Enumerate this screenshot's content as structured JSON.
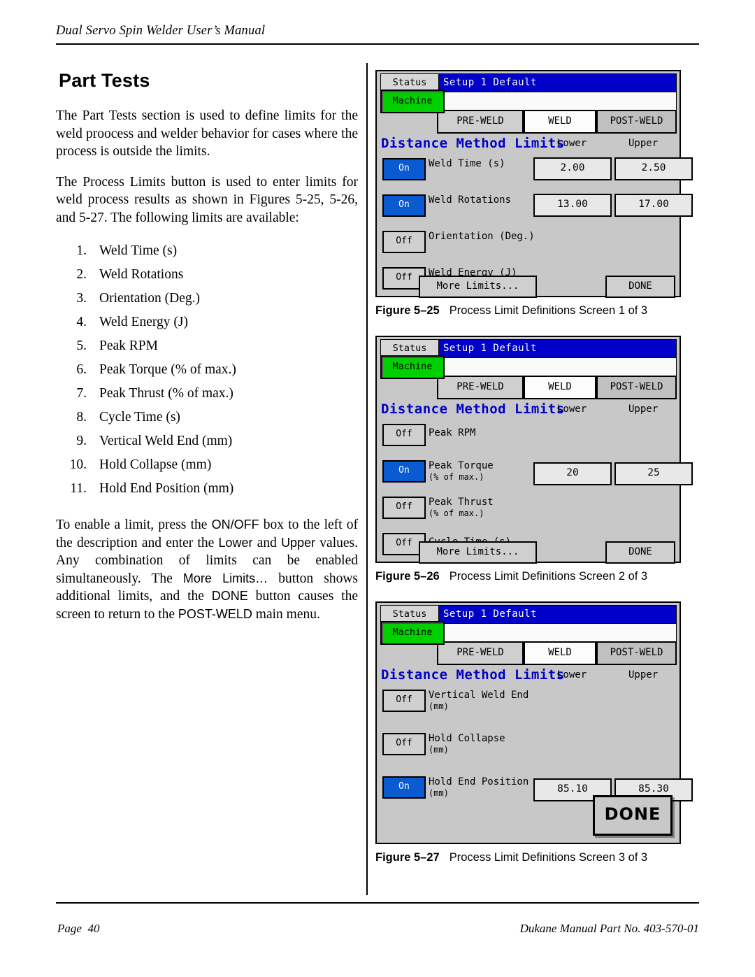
{
  "header": {
    "title": "Dual Servo Spin Welder User’s Manual"
  },
  "footer": {
    "page_label": "Page",
    "page_number": "40",
    "part": "Dukane Manual Part No. 403-570-01"
  },
  "left": {
    "heading": "Part Tests",
    "para1": "The Part Tests section is used to define limits for the weld proocess and welder behavior for cases where the process is outside the limits.",
    "para2": "The Process Limits button is used to enter limits for weld process results as shown in Figures 5-25, 5-26, and 5-27. The following limits are available:",
    "limits": [
      {
        "num": "1.",
        "label": "Weld Time (s)"
      },
      {
        "num": "2.",
        "label": "Weld Rotations"
      },
      {
        "num": "3.",
        "label": "Orientation (Deg.)"
      },
      {
        "num": "4.",
        "label": "Weld Energy (J)"
      },
      {
        "num": "5.",
        "label": "Peak RPM"
      },
      {
        "num": "6.",
        "label": "Peak Torque (% of max.)"
      },
      {
        "num": "7.",
        "label": "Peak Thrust (% of max.)"
      },
      {
        "num": "8.",
        "label": "Cycle Time (s)"
      },
      {
        "num": "9.",
        "label": "Vertical Weld End (mm)"
      },
      {
        "num": "10.",
        "label": "Hold Collapse (mm)"
      },
      {
        "num": "11.",
        "label": "Hold End Position (mm)"
      }
    ],
    "para3_a": "To enable a limit, press the ",
    "para3_on_off": "ON/OFF",
    "para3_b": " box to the left of the description and enter the ",
    "para3_lower": "Lower",
    "para3_c": " and ",
    "para3_upper": "Upper",
    "para3_d": " values. Any combination of limits can be enabled simultaneously. The ",
    "para3_more": "More Limits…",
    "para3_e": " button shows additional limits, and the ",
    "para3_done": "DONE",
    "para3_f": " button causes the screen to return to the ",
    "para3_post": "POST-WELD",
    "para3_g": " main menu."
  },
  "screens": [
    {
      "status_tab": "Status",
      "title": "Setup 1   Default",
      "machine": "Machine",
      "nav": {
        "pre": "PRE-WELD",
        "weld": "WELD",
        "post": "POST-WELD"
      },
      "dml": "Distance Method Limits",
      "lower": "Lower",
      "upper": "Upper",
      "rows": [
        {
          "state": "On",
          "label": "Weld Time (s)",
          "sub": "",
          "lo": "2.00",
          "hi": "2.50"
        },
        {
          "state": "On",
          "label": "Weld Rotations",
          "sub": "",
          "lo": "13.00",
          "hi": "17.00"
        },
        {
          "state": "Off",
          "label": "Orientation (Deg.)",
          "sub": "",
          "lo": "",
          "hi": ""
        },
        {
          "state": "Off",
          "label": "Weld Energy (J)",
          "sub": "",
          "lo": "",
          "hi": ""
        }
      ],
      "more": "More Limits...",
      "done": "DONE",
      "caption_num": "Figure 5–25",
      "caption_txt": "Process Limit Definitions Screen 1 of 3"
    },
    {
      "status_tab": "Status",
      "title": "Setup 1   Default",
      "machine": "Machine",
      "nav": {
        "pre": "PRE-WELD",
        "weld": "WELD",
        "post": "POST-WELD"
      },
      "dml": "Distance Method Limits",
      "lower": "Lower",
      "upper": "Upper",
      "rows": [
        {
          "state": "Off",
          "label": "Peak RPM",
          "sub": "",
          "lo": "",
          "hi": ""
        },
        {
          "state": "On",
          "label": "Peak Torque",
          "sub": "(% of max.)",
          "lo": "20",
          "hi": "25"
        },
        {
          "state": "Off",
          "label": "Peak Thrust",
          "sub": "(% of max.)",
          "lo": "",
          "hi": ""
        },
        {
          "state": "Off",
          "label": "Cycle Time (s)",
          "sub": "",
          "lo": "",
          "hi": ""
        }
      ],
      "more": "More Limits...",
      "done": "DONE",
      "caption_num": "Figure 5–26",
      "caption_txt": "Process Limit Definitions Screen 2 of 3"
    },
    {
      "status_tab": "Status",
      "title": "Setup 1   Default",
      "machine": "Machine",
      "nav": {
        "pre": "PRE-WELD",
        "weld": "WELD",
        "post": "POST-WELD"
      },
      "dml": "Distance Method Limits",
      "lower": "Lower",
      "upper": "Upper",
      "rows": [
        {
          "state": "Off",
          "label": "Vertical Weld End",
          "sub": "(mm)",
          "lo": "",
          "hi": ""
        },
        {
          "state": "Off",
          "label": "Hold Collapse",
          "sub": "(mm)",
          "lo": "",
          "hi": ""
        },
        {
          "state": "On",
          "label": "Hold End Position",
          "sub": "(mm)",
          "lo": "85.10",
          "hi": "85.30"
        }
      ],
      "done_big": "DONE",
      "caption_num": "Figure 5–27",
      "caption_txt": "Process Limit Definitions Screen 3 of 3"
    }
  ]
}
